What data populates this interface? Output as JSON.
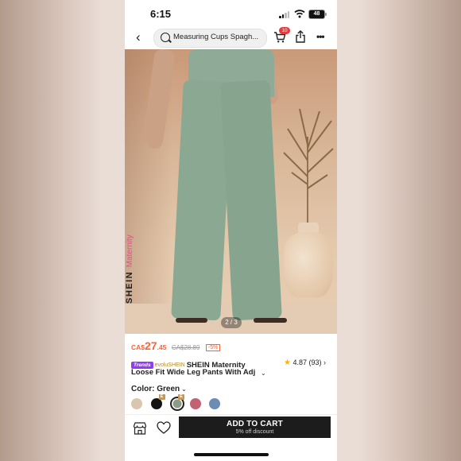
{
  "status_bar": {
    "time": "6:15",
    "battery": "48"
  },
  "nav": {
    "search_text": "Measuring Cups Spagh...",
    "cart_count": "10"
  },
  "photo": {
    "watermark_brand": "SHEIN",
    "watermark_line": "Maternity",
    "pager": "2 / 3"
  },
  "price": {
    "currency": "CA$",
    "whole": "27",
    "decimal": ".45",
    "original": "CA$28.89",
    "discount": "-5%"
  },
  "product": {
    "trends_tag": "Trends",
    "store_tag": "evoluSHEIN",
    "title_line1": "SHEIN Maternity",
    "title_line2": "Loose Fit Wide Leg Pants With Adj",
    "rating": "4.87",
    "review_count": "(93)"
  },
  "color": {
    "label": "Color: Green",
    "swatches": [
      {
        "name": "beige",
        "hex": "#dbc5ad"
      },
      {
        "name": "black",
        "hex": "#141414",
        "tag": "E"
      },
      {
        "name": "green",
        "hex": "#8b9c87",
        "tag": "E",
        "selected": true
      },
      {
        "name": "rose",
        "hex": "#c26372"
      },
      {
        "name": "blue",
        "hex": "#6c8bb5"
      }
    ]
  },
  "actions": {
    "add_to_cart": "ADD TO CART",
    "promo": "5% off discount"
  },
  "colors": {
    "accent": "#fa6338",
    "button": "#1c1c1c",
    "badge": "#e8393d"
  }
}
